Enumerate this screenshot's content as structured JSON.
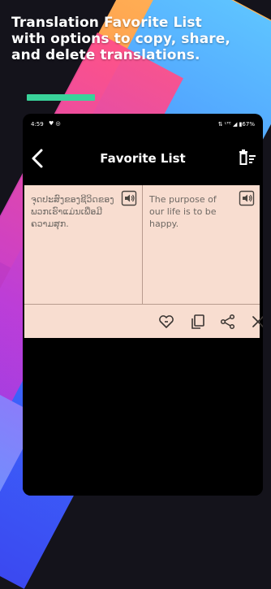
{
  "promo": {
    "headline_line1": "Translation Favorite List",
    "headline_line2": "with options to copy, share,",
    "headline_line3": "and delete translations.",
    "accent_color": "#39d39a"
  },
  "status_bar": {
    "time": "4:59",
    "icons_left": "♥ ◎",
    "right": "⇅ ᴸᵀᴱ ◢ ▮67%"
  },
  "app_bar": {
    "title": "Favorite List",
    "back_icon": "back-arrow-icon",
    "delete_all_icon": "delete-all-icon"
  },
  "favorites": [
    {
      "source_text": "ຈຸດປະສົງຂອງຊີວິດຂອງພວກເຮົາແມ່ນເພື່ອມີຄວາມສຸກ.",
      "translated_text": "The purpose of our life is to be happy.",
      "actions": [
        "favorite-remove-icon",
        "copy-icon",
        "share-icon",
        "close-icon"
      ]
    }
  ],
  "colors": {
    "card_background": "#f8ddd0",
    "text_color": "#6f6964",
    "screen_background": "#000000"
  }
}
